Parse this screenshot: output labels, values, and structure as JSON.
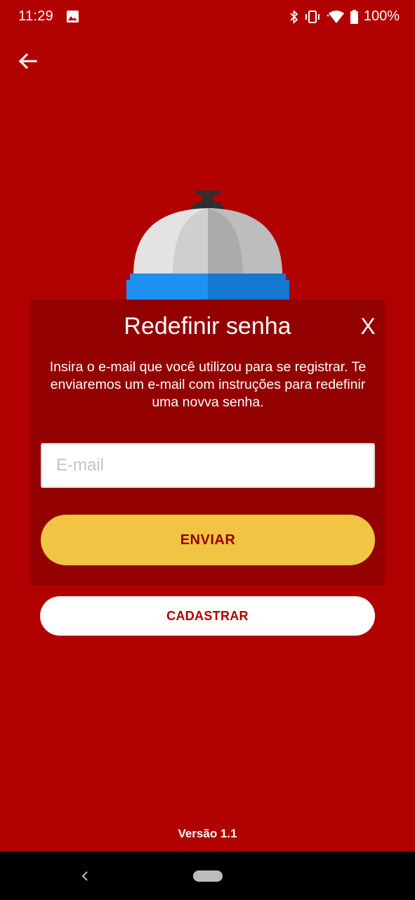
{
  "status_bar": {
    "time": "11:29",
    "battery": "100%",
    "icons": [
      "image-icon",
      "bluetooth-icon",
      "vibrate-icon",
      "wifi-icon",
      "battery-icon"
    ]
  },
  "app_bar": {
    "back_icon": "arrow-left-icon"
  },
  "illustration": {
    "icon": "service-bell-icon"
  },
  "dialog": {
    "title": "Redefinir senha",
    "close_label": "X",
    "message": "Insira o e-mail que você utilizou para se registrar. Te enviaremos um e-mail com instruções para redefinir uma novva senha.",
    "email": {
      "value": "",
      "placeholder": "E-mail"
    },
    "send_label": "ENVIAR"
  },
  "register_label": "CADASTRAR",
  "version": "Versão 1.1",
  "colors": {
    "background": "#b00000",
    "dialog": "#930000",
    "send_button": "#f2c443",
    "send_text": "#930000",
    "register_button": "#ffffff",
    "register_text": "#b00000"
  },
  "nav_bar": {
    "back_icon": "chevron-left-icon",
    "home_icon": "home-pill-icon"
  }
}
